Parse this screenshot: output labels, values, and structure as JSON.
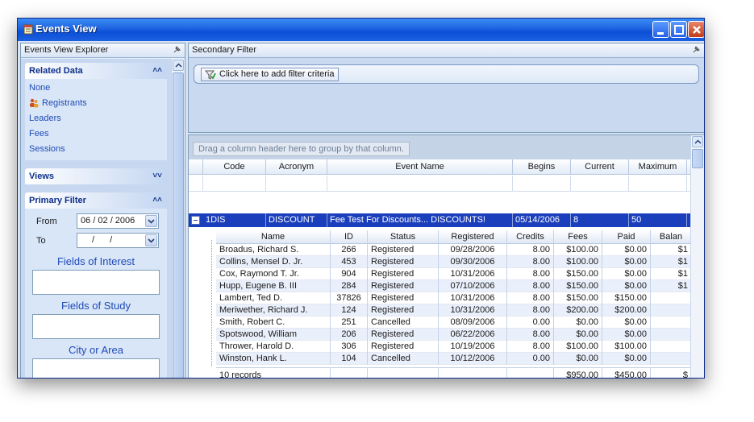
{
  "window": {
    "title": "Events View"
  },
  "explorer": {
    "title": "Events View Explorer",
    "related_data": {
      "header": "Related Data",
      "items": [
        "None",
        "Registrants",
        "Leaders",
        "Fees",
        "Sessions"
      ]
    },
    "views": {
      "header": "Views"
    },
    "primary_filter": {
      "header": "Primary Filter",
      "from_label": "From",
      "from_value": "06 / 02 / 2006",
      "to_label": "To",
      "to_value": "/ /",
      "fields_of_interest": "Fields of Interest",
      "fields_of_study": "Fields of Study",
      "city_or_area": "City or Area"
    }
  },
  "secondary_filter": {
    "title": "Secondary Filter",
    "add_criteria": "Click here to add filter criteria"
  },
  "grid": {
    "group_hint": "Drag a column header here to group by that column.",
    "columns": [
      "Code",
      "Acronym",
      "Event Name",
      "Begins",
      "Current",
      "Maximum"
    ],
    "event_row": {
      "code": "1DIS",
      "acronym": "DISCOUNT",
      "name": "Fee Test For Discounts... DISCOUNTS!",
      "begins": "05/14/2006",
      "current": "8",
      "maximum": "50"
    },
    "child_columns": [
      "Name",
      "ID",
      "Status",
      "Registered",
      "Credits",
      "Fees",
      "Paid",
      "Balan"
    ],
    "registrants": [
      {
        "name": "Broadus, Richard S.",
        "id": "266",
        "status": "Registered",
        "registered": "09/28/2006",
        "credits": "8.00",
        "fees": "$100.00",
        "paid": "$0.00",
        "balance": "$1"
      },
      {
        "name": "Collins, Mensel D. Jr.",
        "id": "453",
        "status": "Registered",
        "registered": "09/30/2006",
        "credits": "8.00",
        "fees": "$100.00",
        "paid": "$0.00",
        "balance": "$1"
      },
      {
        "name": "Cox, Raymond T. Jr.",
        "id": "904",
        "status": "Registered",
        "registered": "10/31/2006",
        "credits": "8.00",
        "fees": "$150.00",
        "paid": "$0.00",
        "balance": "$1"
      },
      {
        "name": "Hupp, Eugene B. III",
        "id": "284",
        "status": "Registered",
        "registered": "07/10/2006",
        "credits": "8.00",
        "fees": "$150.00",
        "paid": "$0.00",
        "balance": "$1"
      },
      {
        "name": "Lambert, Ted D.",
        "id": "37826",
        "status": "Registered",
        "registered": "10/31/2006",
        "credits": "8.00",
        "fees": "$150.00",
        "paid": "$150.00",
        "balance": ""
      },
      {
        "name": "Meriwether, Richard J.",
        "id": "124",
        "status": "Registered",
        "registered": "10/31/2006",
        "credits": "8.00",
        "fees": "$200.00",
        "paid": "$200.00",
        "balance": ""
      },
      {
        "name": "Smith, Robert C.",
        "id": "251",
        "status": "Cancelled",
        "registered": "08/09/2006",
        "credits": "0.00",
        "fees": "$0.00",
        "paid": "$0.00",
        "balance": ""
      },
      {
        "name": "Spotswood, William",
        "id": "206",
        "status": "Registered",
        "registered": "06/22/2006",
        "credits": "8.00",
        "fees": "$0.00",
        "paid": "$0.00",
        "balance": ""
      },
      {
        "name": "Thrower, Harold D.",
        "id": "306",
        "status": "Registered",
        "registered": "10/19/2006",
        "credits": "8.00",
        "fees": "$100.00",
        "paid": "$100.00",
        "balance": ""
      },
      {
        "name": "Winston, Hank L.",
        "id": "104",
        "status": "Cancelled",
        "registered": "10/12/2006",
        "credits": "0.00",
        "fees": "$0.00",
        "paid": "$0.00",
        "balance": ""
      }
    ],
    "summary": {
      "records": "10 records",
      "fees_total": "$950.00",
      "paid_total": "$450.00",
      "balance_total": "$"
    }
  },
  "colors": {
    "title_bar": "#1e63e0",
    "selected_row": "#1b3fbc",
    "link": "#1f4bb6",
    "panel": "#d9e6f8"
  },
  "icons": [
    "app-icon",
    "minimize-icon",
    "maximize-icon",
    "close-icon",
    "pin-icon",
    "registrants-icon",
    "collapse-chevron-icon",
    "expand-chevron-icon",
    "dropdown-arrow-icon",
    "filter-add-icon",
    "expand-minus-icon"
  ]
}
